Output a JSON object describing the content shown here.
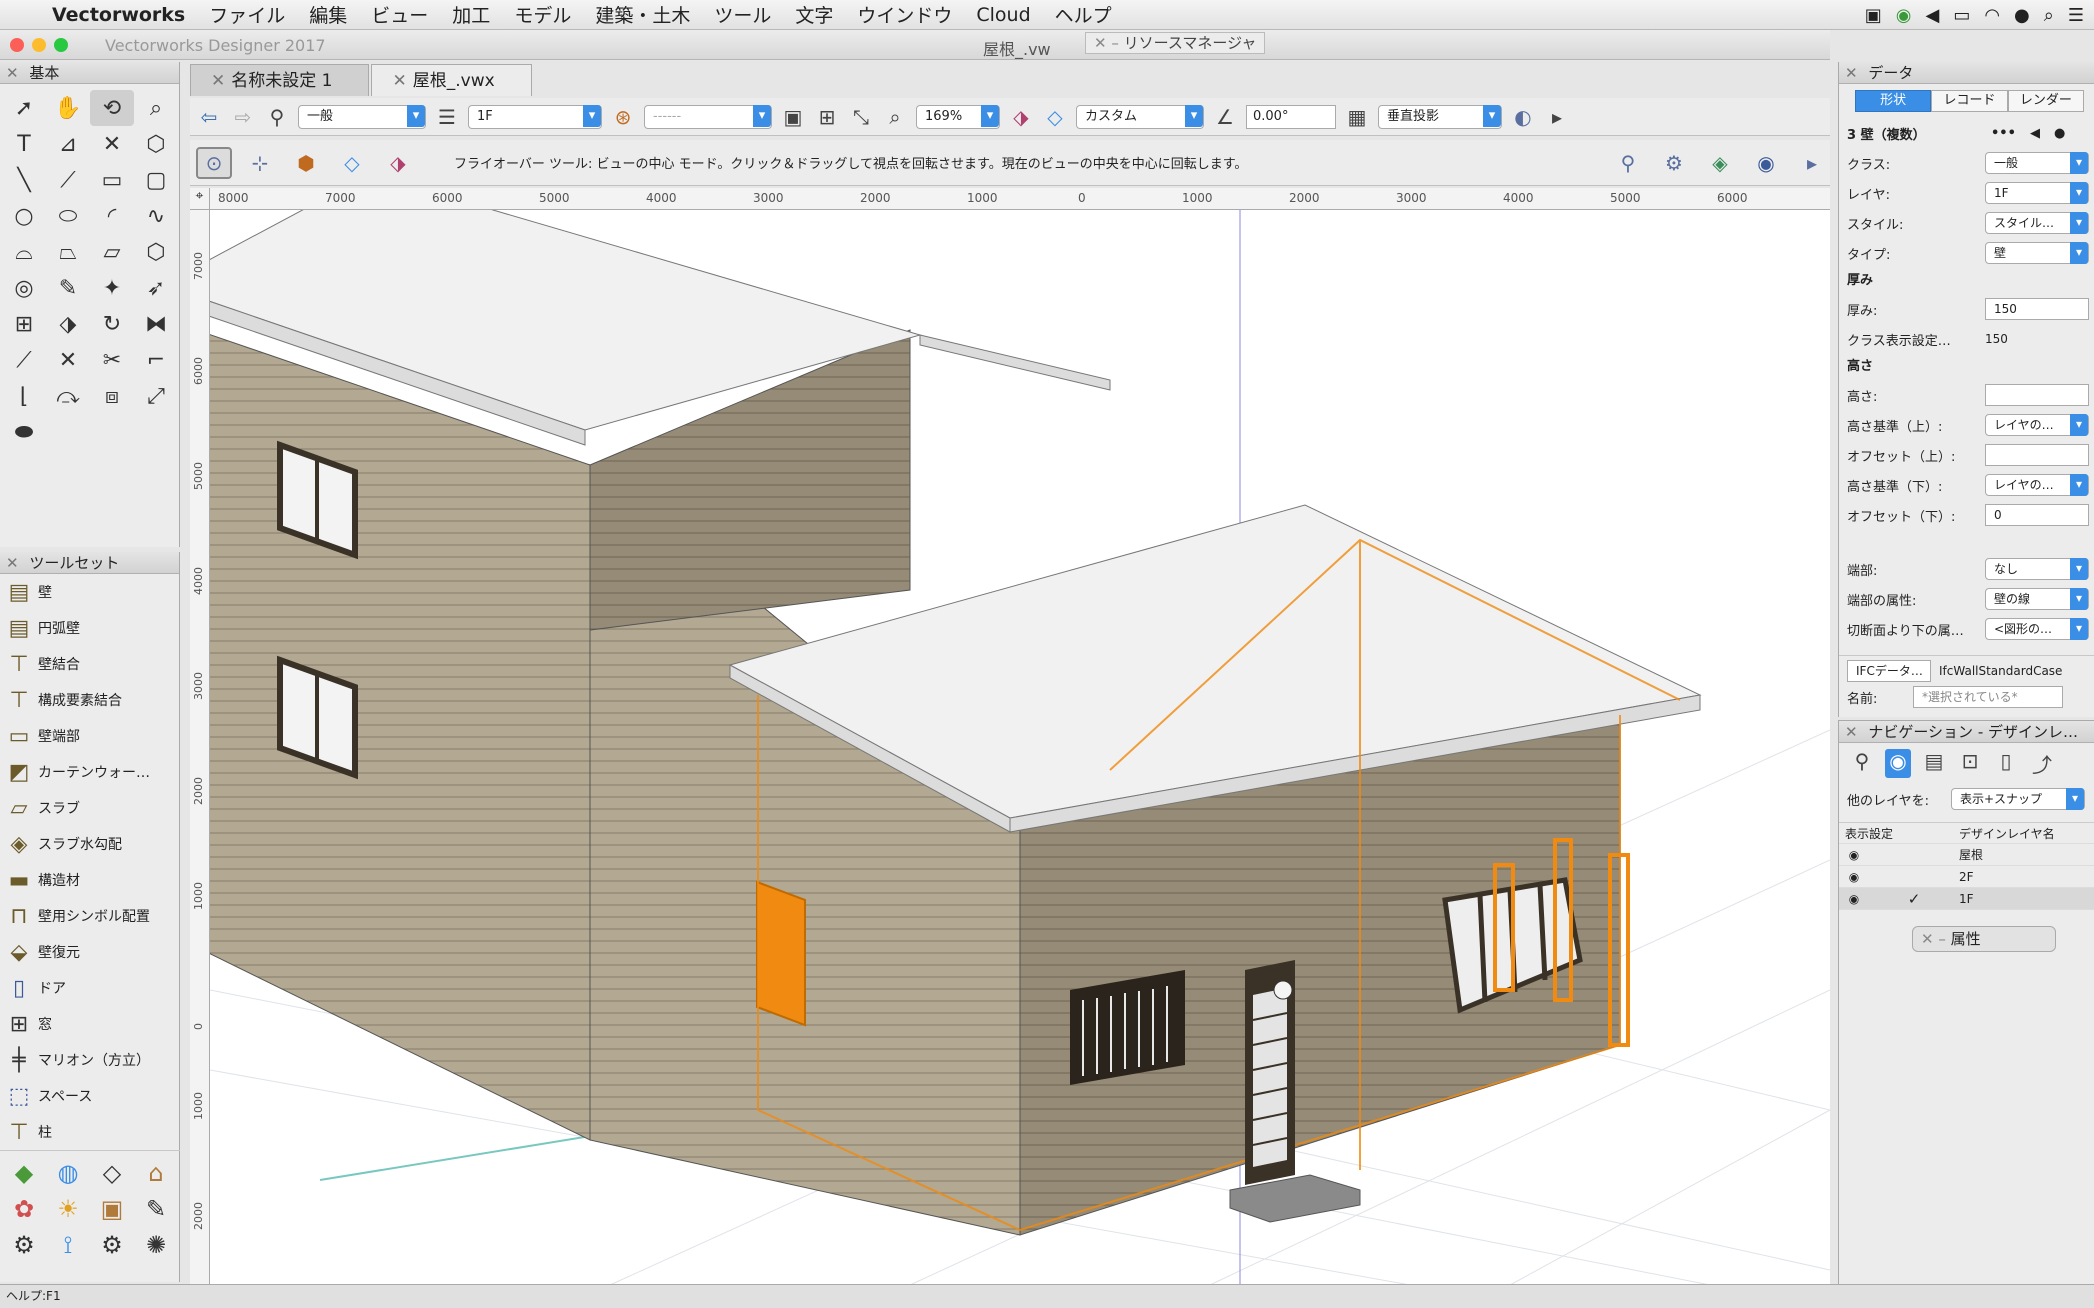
{
  "menubar": {
    "app_name": "Vectorworks",
    "items": [
      "ファイル",
      "編集",
      "ビュー",
      "加工",
      "モデル",
      "建築・土木",
      "ツール",
      "文字",
      "ウインドウ",
      "Cloud",
      "ヘルプ"
    ]
  },
  "window": {
    "app_title": "Vectorworks Designer 2017",
    "doc_title": "屋根_.vw",
    "resource_manager": "リソースマネージャ"
  },
  "palettes": {
    "basic_title": "基本",
    "toolset_title": "ツールセット",
    "toolset_items": [
      "壁",
      "円弧壁",
      "壁結合",
      "構成要素結合",
      "壁端部",
      "カーテンウォー…",
      "スラブ",
      "スラブ水勾配",
      "構造材",
      "壁用シンボル配置",
      "壁復元",
      "ドア",
      "窓",
      "マリオン（方立）",
      "スペース",
      "柱"
    ]
  },
  "tabs": [
    {
      "label": "名称未設定 1"
    },
    {
      "label": "屋根_.vwx"
    }
  ],
  "viewbar": {
    "class": "一般",
    "layer": "1F",
    "zoom": "169%",
    "render_mode": "カスタム",
    "angle": "0.00°",
    "projection": "垂直投影"
  },
  "modebar": {
    "help_text": "フライオーバー ツール: ビューの中心 モード。クリック＆ドラッグして視点を回転させます。現在のビューの中央を中心に回転します。"
  },
  "rulers": {
    "top": [
      "8000",
      "7000",
      "6000",
      "5000",
      "4000",
      "3000",
      "2000",
      "1000",
      "0",
      "1000",
      "2000",
      "3000",
      "4000",
      "5000",
      "6000"
    ],
    "left": [
      "7000",
      "6000",
      "5000",
      "4000",
      "3000",
      "2000",
      "1000",
      "0",
      "1000",
      "2000"
    ]
  },
  "obj_info": {
    "title": "データ",
    "tabs": [
      "形状",
      "レコード",
      "レンダー"
    ],
    "selection": "3 壁（複数）",
    "rows": {
      "class_label": "クラス:",
      "class_value": "一般",
      "layer_label": "レイヤ:",
      "layer_value": "1F",
      "style_label": "スタイル:",
      "style_value": "スタイル…",
      "type_label": "タイプ:",
      "type_value": "壁",
      "thickness_section": "厚み",
      "thickness_label": "厚み:",
      "thickness_value": "150",
      "class_disp_label": "クラス表示設定…",
      "class_disp_value": "150",
      "height_section": "高さ",
      "height_label": "高さ:",
      "height_value": "",
      "top_bound_label": "高さ基準（上）:",
      "top_bound_value": "レイヤの…",
      "top_offset_label": "オフセット（上）:",
      "top_offset_value": "",
      "bot_bound_label": "高さ基準（下）:",
      "bot_bound_value": "レイヤの…",
      "bot_offset_label": "オフセット（下）:",
      "bot_offset_value": "0",
      "cap_label": "端部:",
      "cap_value": "なし",
      "cap_attr_label": "端部の属性:",
      "cap_attr_value": "壁の線",
      "cut_label": "切断面より下の属…",
      "cut_value": "<図形の…",
      "ifc_label": "IFCデータ…",
      "ifc_value": "IfcWallStandardCase",
      "name_label": "名前:",
      "name_value": "*選択されている*"
    }
  },
  "navigation": {
    "title": "ナビゲーション - デザインレ…",
    "other_layers_label": "他のレイヤを:",
    "other_layers_value": "表示+スナップ",
    "col_visibility": "表示設定",
    "col_layer_name": "デザインレイヤ名",
    "layers": [
      {
        "name": "屋根",
        "active": ""
      },
      {
        "name": "2F",
        "active": ""
      },
      {
        "name": "1F",
        "active": "✓"
      }
    ]
  },
  "attributes_title": "属性",
  "status": "ヘルプ:F1",
  "colors": {
    "accent": "#3a8ee6",
    "selection_highlight": "#f08a10",
    "siding": "#b3a891",
    "siding_dark": "#8e8470",
    "roof": "#f1f1f1"
  }
}
